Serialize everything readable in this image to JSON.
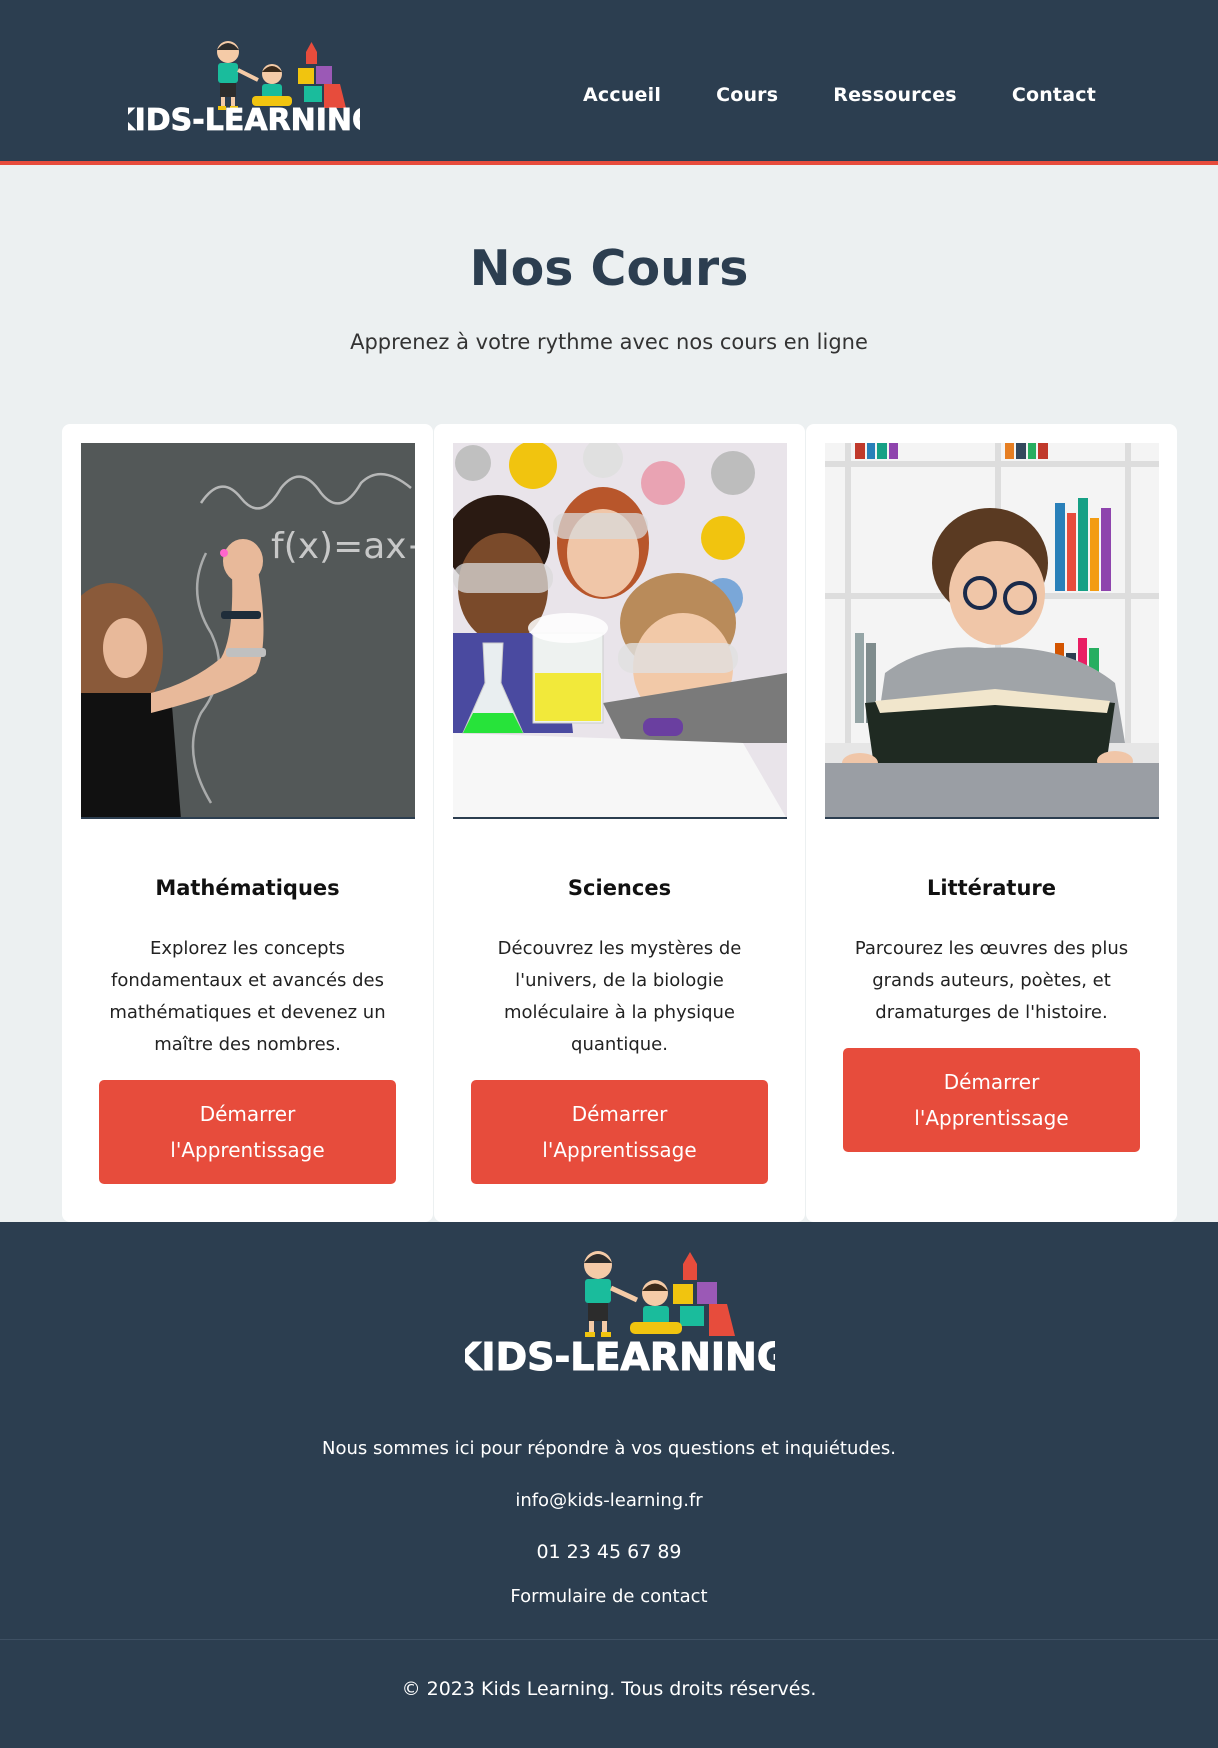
{
  "header": {
    "logo_text": "KIDS-LEARNING",
    "nav": [
      "Accueil",
      "Cours",
      "Ressources",
      "Contact"
    ]
  },
  "hero": {
    "title": "Nos Cours",
    "subtitle": "Apprenez à votre rythme avec nos cours en ligne"
  },
  "courses": [
    {
      "title": "Mathématiques",
      "description": "Explorez les concepts fondamentaux et avancés des mathématiques et devenez un maître des nombres.",
      "button": "Démarrer l'Apprentissage",
      "photo_text": "f(x)=ax+"
    },
    {
      "title": "Sciences",
      "description": "Découvrez les mystères de l'univers, de la biologie moléculaire à la physique quantique.",
      "button": "Démarrer l'Apprentissage"
    },
    {
      "title": "Littérature",
      "description": "Parcourez les œuvres des plus grands auteurs, poètes, et dramaturges de l'histoire.",
      "button": "Démarrer l'Apprentissage"
    }
  ],
  "footer": {
    "logo_text": "KIDS-LEARNING",
    "tagline": "Nous sommes ici pour répondre à vos questions et inquiétudes.",
    "email": "info@kids-learning.fr",
    "phone": "01 23 45 67 89",
    "contact_link": "Formulaire de contact",
    "copyright": "© 2023 Kids Learning. Tous droits réservés."
  },
  "colors": {
    "dark": "#2c3e50",
    "accent": "#e74c3c",
    "background": "#ecf0f1"
  }
}
